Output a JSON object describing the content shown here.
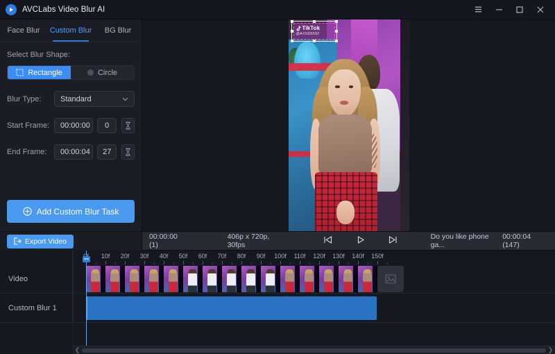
{
  "window": {
    "title": "AVCLabs Video Blur AI",
    "logo_icon": "play-logo-icon",
    "menu_icon": "hamburger-menu-icon",
    "minimize_icon": "minimize-icon",
    "maximize_icon": "maximize-icon",
    "close_icon": "close-icon"
  },
  "tabs": [
    {
      "label": "Face Blur",
      "active": false
    },
    {
      "label": "Custom Blur",
      "active": true
    },
    {
      "label": "BG Blur",
      "active": false
    }
  ],
  "panel": {
    "shape_section_label": "Select Blur Shape:",
    "shapes": [
      {
        "label": "Rectangle",
        "selected": true,
        "icon": "rectangle-marquee-icon"
      },
      {
        "label": "Circle",
        "selected": false,
        "icon": "circle-radio-icon"
      }
    ],
    "blur_type": {
      "label": "Blur Type:",
      "value": "Standard",
      "chevron_icon": "chevron-down-icon"
    },
    "start_frame": {
      "label": "Start Frame:",
      "time": "00:00:00",
      "frame": "0",
      "icon": "hourglass-icon"
    },
    "end_frame": {
      "label": "End Frame:",
      "time": "00:00:04",
      "frame": "27",
      "icon": "hourglass-icon"
    },
    "add_task_label": "Add Custom Blur Task",
    "add_task_icon": "plus-circle-icon",
    "export_label": "Export Video",
    "export_icon": "export-arrow-icon"
  },
  "preview": {
    "watermark": {
      "brand": "TikTok",
      "handle": "@AXSD6592",
      "brand_icon": "tiktok-note-icon"
    }
  },
  "player": {
    "time_in": "00:00:00 (1)",
    "resolution": "406p x 720p, 30fps",
    "prev_icon": "skip-previous-icon",
    "play_icon": "play-icon",
    "next_icon": "skip-next-icon",
    "caption": "Do you like phone ga...",
    "time_out": "00:00:04 (147)"
  },
  "timeline": {
    "ruler_ticks": [
      "0f",
      "10f",
      "20f",
      "30f",
      "40f",
      "50f",
      "60f",
      "70f",
      "80f",
      "90f",
      "100f",
      "110f",
      "120f",
      "130f",
      "140f",
      "150f"
    ],
    "tracks": [
      {
        "label": "Video"
      },
      {
        "label": "Custom Blur 1"
      }
    ],
    "placeholder_icon": "image-placeholder-icon",
    "scroll_left_icon": "scroll-left-arrow-icon",
    "scroll_right_icon": "scroll-right-arrow-icon"
  },
  "colors": {
    "accent": "#4a9af2",
    "accent_tab": "#4a9eff",
    "clip": "#2a72c4",
    "panel_bg": "#1a1d24",
    "titlebar_bg": "#141720",
    "playerbar_bg": "#272b33"
  }
}
